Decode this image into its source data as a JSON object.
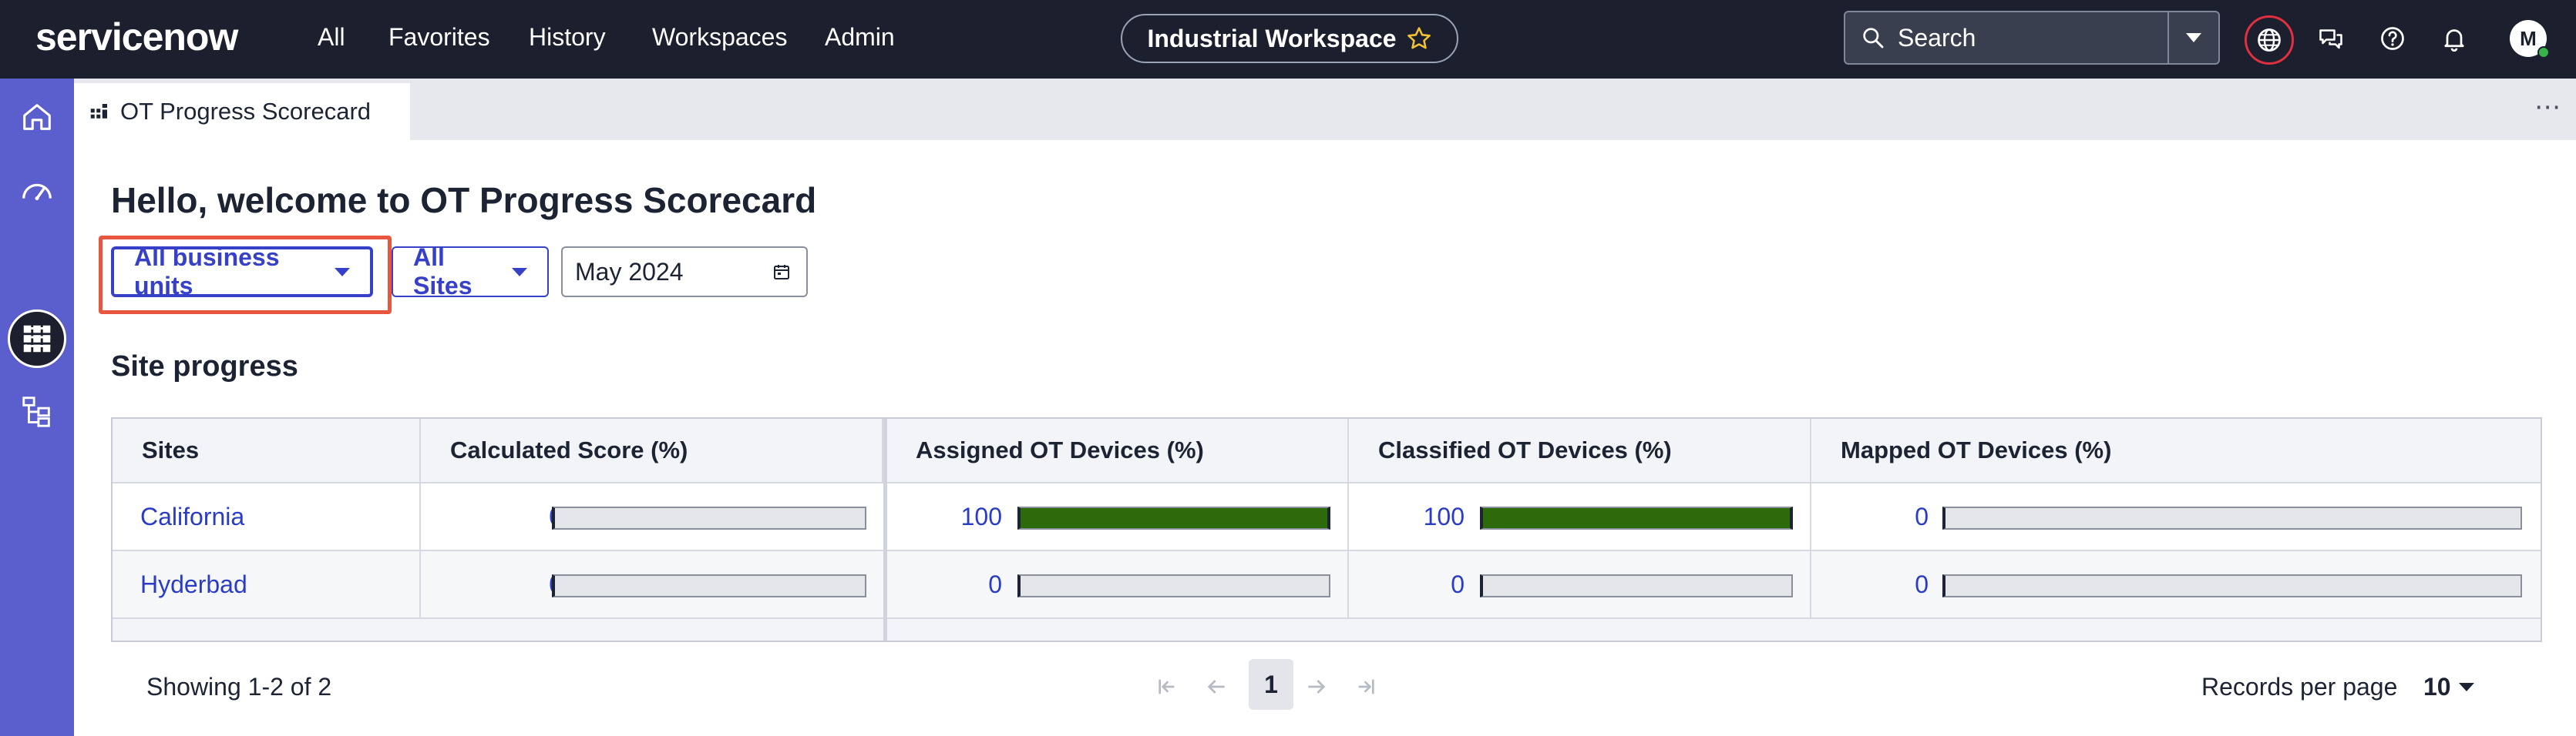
{
  "header": {
    "logo": "servicenow",
    "nav": [
      "All",
      "Favorites",
      "History",
      "Workspaces",
      "Admin"
    ],
    "workspace_pill": "Industrial Workspace",
    "search_placeholder": "Search",
    "avatar_initial": "M",
    "icons": [
      "globe-icon",
      "chat-icon",
      "help-icon",
      "bell-icon"
    ]
  },
  "sidebar": {
    "icons": [
      "home-icon",
      "dashboard-gauge-icon",
      "grid-apps-icon",
      "list-icon",
      "hierarchy-icon"
    ],
    "active": "grid-apps-icon"
  },
  "tab": {
    "label": "OT Progress Scorecard",
    "more": "⋯"
  },
  "main": {
    "welcome": "Hello, welcome to OT Progress Scorecard",
    "filters": {
      "business_units": "All business units",
      "sites": "All Sites",
      "date": "May 2024"
    },
    "section_title": "Site progress"
  },
  "table": {
    "columns": [
      "Sites",
      "Calculated Score (%)",
      "Assigned OT Devices (%)",
      "Classified OT Devices (%)",
      "Mapped OT Devices (%)"
    ],
    "rows": [
      {
        "site": "California",
        "calculated": "0",
        "assigned": "100",
        "classified": "100",
        "mapped": "0"
      },
      {
        "site": "Hyderbad",
        "calculated": "0",
        "assigned": "0",
        "classified": "0",
        "mapped": "0"
      }
    ],
    "progress": [
      {
        "calculated": 0,
        "assigned": 1.0,
        "classified": 1.0,
        "mapped": 0
      },
      {
        "calculated": 0,
        "assigned": 0,
        "classified": 0,
        "mapped": 0
      }
    ]
  },
  "footer": {
    "showing": "Showing 1-2 of 2",
    "current_page": "1",
    "records_label": "Records per page",
    "records_value": "10"
  },
  "colors": {
    "topbar": "#1b1f2e",
    "sidebar": "#5b5ecd",
    "accent": "#3640c8",
    "link": "#2a3cc6",
    "bar_fill": "#2d6a0a",
    "highlight": "#e8563f"
  }
}
